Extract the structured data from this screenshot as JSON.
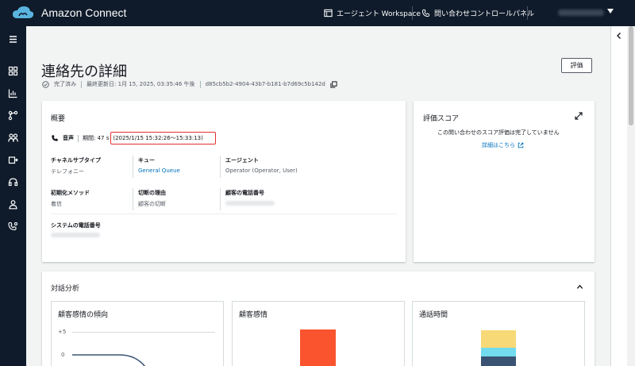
{
  "topbar": {
    "brand": "Amazon Connect",
    "workspace_link": "エージェント Workspace",
    "ccp_link": "問い合わせコントロールパネル"
  },
  "header": {
    "title": "連絡先の詳細",
    "status": "完了済み",
    "last_updated": "最終更新日: 1月 15, 2025, 03:35:46 午後",
    "contact_id": "d85cb5b2-4904-43b7-b181-b7d69c5b142d",
    "eval_button": "評価"
  },
  "summary": {
    "title": "概要",
    "channel": "音声",
    "duration": "期間: 47 s",
    "time_range": "(2025/1/15 15:32:26～15:33:13)",
    "fields": {
      "channel_subtype_label": "チャネルサブタイプ",
      "channel_subtype_value": "テレフォニー",
      "queue_label": "キュー",
      "queue_value": "General Queue",
      "agent_label": "エージェント",
      "agent_value": "Operator (Operator, User)",
      "init_method_label": "初期化メソッド",
      "init_method_value": "着信",
      "disconnect_label": "切断の理由",
      "disconnect_value": "顧客の切断",
      "customer_phone_label": "顧客の電話番号",
      "system_phone_label": "システムの電話番号"
    }
  },
  "score": {
    "title": "評価スコア",
    "message": "この問い合わせのスコア評価は完了していません",
    "details_link": "詳細はこちら"
  },
  "analysis": {
    "title": "対話分析",
    "cards": {
      "trend_title": "顧客感情の傾向",
      "trend_tick_top": "+5",
      "trend_tick_zero": "0",
      "sentiment_title": "顧客感情",
      "duration_title": "通話時間"
    }
  },
  "colors": {
    "topbar": "#0f1b2a",
    "link": "#0073bb",
    "highlight": "#e22f2f",
    "sentiment_bar": "#f9542e",
    "duration_yellow": "#f8d978",
    "duration_cyan": "#72dbed",
    "duration_navy": "#3a5372"
  }
}
